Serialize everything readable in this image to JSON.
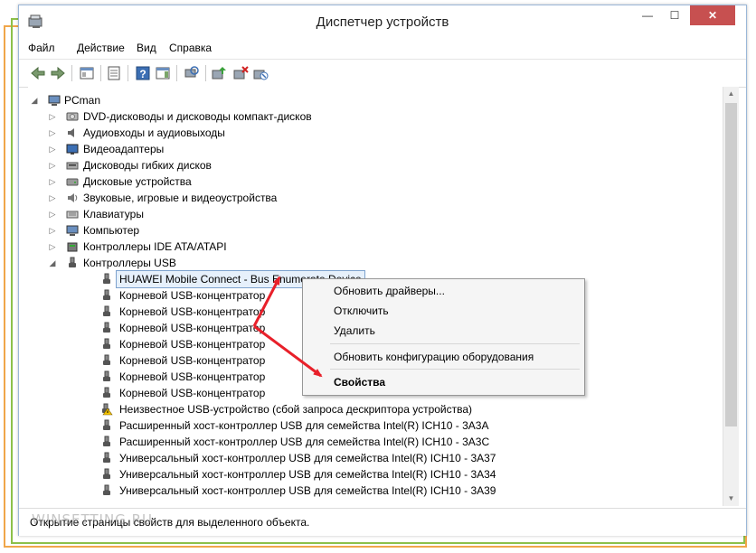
{
  "window": {
    "title": "Диспетчер устройств",
    "minimize_glyph": "—",
    "maximize_glyph": "☐",
    "close_glyph": "✕"
  },
  "menu": [
    "Файл",
    "Действие",
    "Вид",
    "Справка"
  ],
  "tree": {
    "root": "PCman",
    "categories": [
      {
        "label": "DVD-дисководы и дисководы компакт-дисков",
        "icon": "dvd-drive-icon"
      },
      {
        "label": "Аудиовходы и аудиовыходы",
        "icon": "speaker-icon"
      },
      {
        "label": "Видеоадаптеры",
        "icon": "display-adapter-icon"
      },
      {
        "label": "Дисководы гибких дисков",
        "icon": "floppy-drive-icon"
      },
      {
        "label": "Дисковые устройства",
        "icon": "disk-drive-icon"
      },
      {
        "label": "Звуковые, игровые и видеоустройства",
        "icon": "sound-device-icon"
      },
      {
        "label": "Клавиатуры",
        "icon": "keyboard-icon"
      },
      {
        "label": "Компьютер",
        "icon": "computer-icon"
      },
      {
        "label": "Контроллеры IDE ATA/ATAPI",
        "icon": "ide-controller-icon"
      },
      {
        "label": "Контроллеры USB",
        "icon": "usb-controller-icon"
      }
    ],
    "usb_devices": [
      {
        "label": "HUAWEI Mobile Connect - Bus Enumerate Device",
        "warning": false
      },
      {
        "label": "Корневой USB-концентратор",
        "warning": false
      },
      {
        "label": "Корневой USB-концентратор",
        "warning": false
      },
      {
        "label": "Корневой USB-концентратор",
        "warning": false
      },
      {
        "label": "Корневой USB-концентратор",
        "warning": false
      },
      {
        "label": "Корневой USB-концентратор",
        "warning": false
      },
      {
        "label": "Корневой USB-концентратор",
        "warning": false
      },
      {
        "label": "Корневой USB-концентратор",
        "warning": false
      },
      {
        "label": "Неизвестное USB-устройство (сбой запроса дескриптора устройства)",
        "warning": true
      },
      {
        "label": "Расширенный хост-контроллер USB для семейства Intel(R) ICH10 - 3A3A",
        "warning": false
      },
      {
        "label": "Расширенный хост-контроллер USB для семейства Intel(R) ICH10 - 3A3C",
        "warning": false
      },
      {
        "label": "Универсальный хост-контроллер USB для семейства Intel(R) ICH10 - 3A37",
        "warning": false
      },
      {
        "label": "Универсальный хост-контроллер USB для семейства Intel(R) ICH10 - 3A34",
        "warning": false
      },
      {
        "label": "Универсальный хост-контроллер USB для семейства Intel(R) ICH10 - 3A39",
        "warning": false
      }
    ]
  },
  "context_menu": {
    "items": [
      "Обновить драйверы...",
      "Отключить",
      "Удалить",
      "Обновить конфигурацию оборудования",
      "Свойства"
    ]
  },
  "status_text": "Открытие страницы свойств для выделенного объекта.",
  "watermark": "WINSETTING.RU",
  "colors": {
    "annotation_arrow": "#e8202a",
    "selection_border": "#7da2ce",
    "close_button": "#c75050",
    "frame_orange": "#f0a64a",
    "frame_green": "#8cc04a"
  }
}
